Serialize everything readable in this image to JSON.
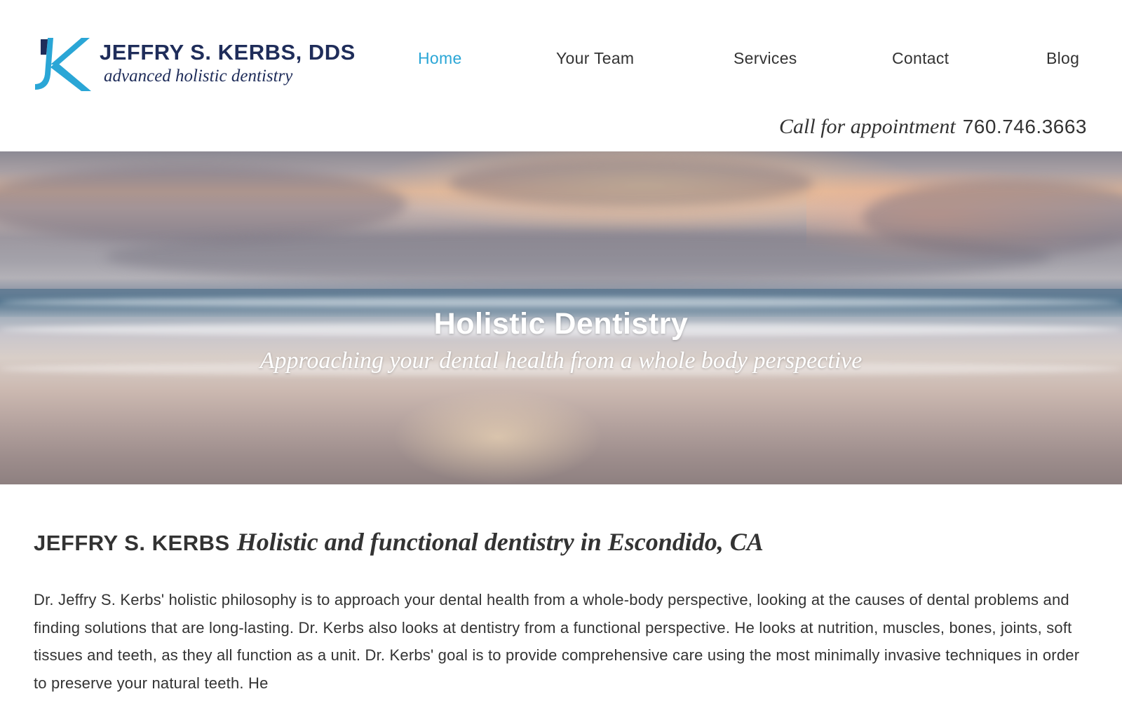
{
  "header": {
    "logo": {
      "mark_letter": "K",
      "name": "JEFFRY S. KERBS, DDS",
      "tagline": "advanced holistic dentistry"
    },
    "nav": [
      {
        "label": "Home",
        "active": true
      },
      {
        "label": "Your Team",
        "active": false
      },
      {
        "label": "Services",
        "active": false
      },
      {
        "label": "Contact",
        "active": false
      },
      {
        "label": "Blog",
        "active": false
      }
    ],
    "call": {
      "label": "Call for appointment",
      "phone": "760.746.3663"
    }
  },
  "hero": {
    "title": "Holistic Dentistry",
    "subtitle": "Approaching your dental health from a whole body perspective"
  },
  "intro": {
    "name": "JEFFRY S. KERBS",
    "subtitle": "Holistic and functional dentistry in Escondido, CA",
    "body": "Dr. Jeffry S. Kerbs' holistic philosophy is to approach your dental health from a whole-body perspective, looking at the causes of dental problems and finding solutions that are long-lasting. Dr. Kerbs also looks at dentistry from a functional perspective. He looks at nutrition, muscles, bones, joints, soft tissues and teeth, as they all function as a unit. Dr. Kerbs' goal is to provide comprehensive care using the most minimally invasive techniques in order to preserve your natural teeth. He"
  },
  "colors": {
    "accent": "#2aa6d6",
    "brand_navy": "#1f2d5a",
    "text": "#333333"
  }
}
